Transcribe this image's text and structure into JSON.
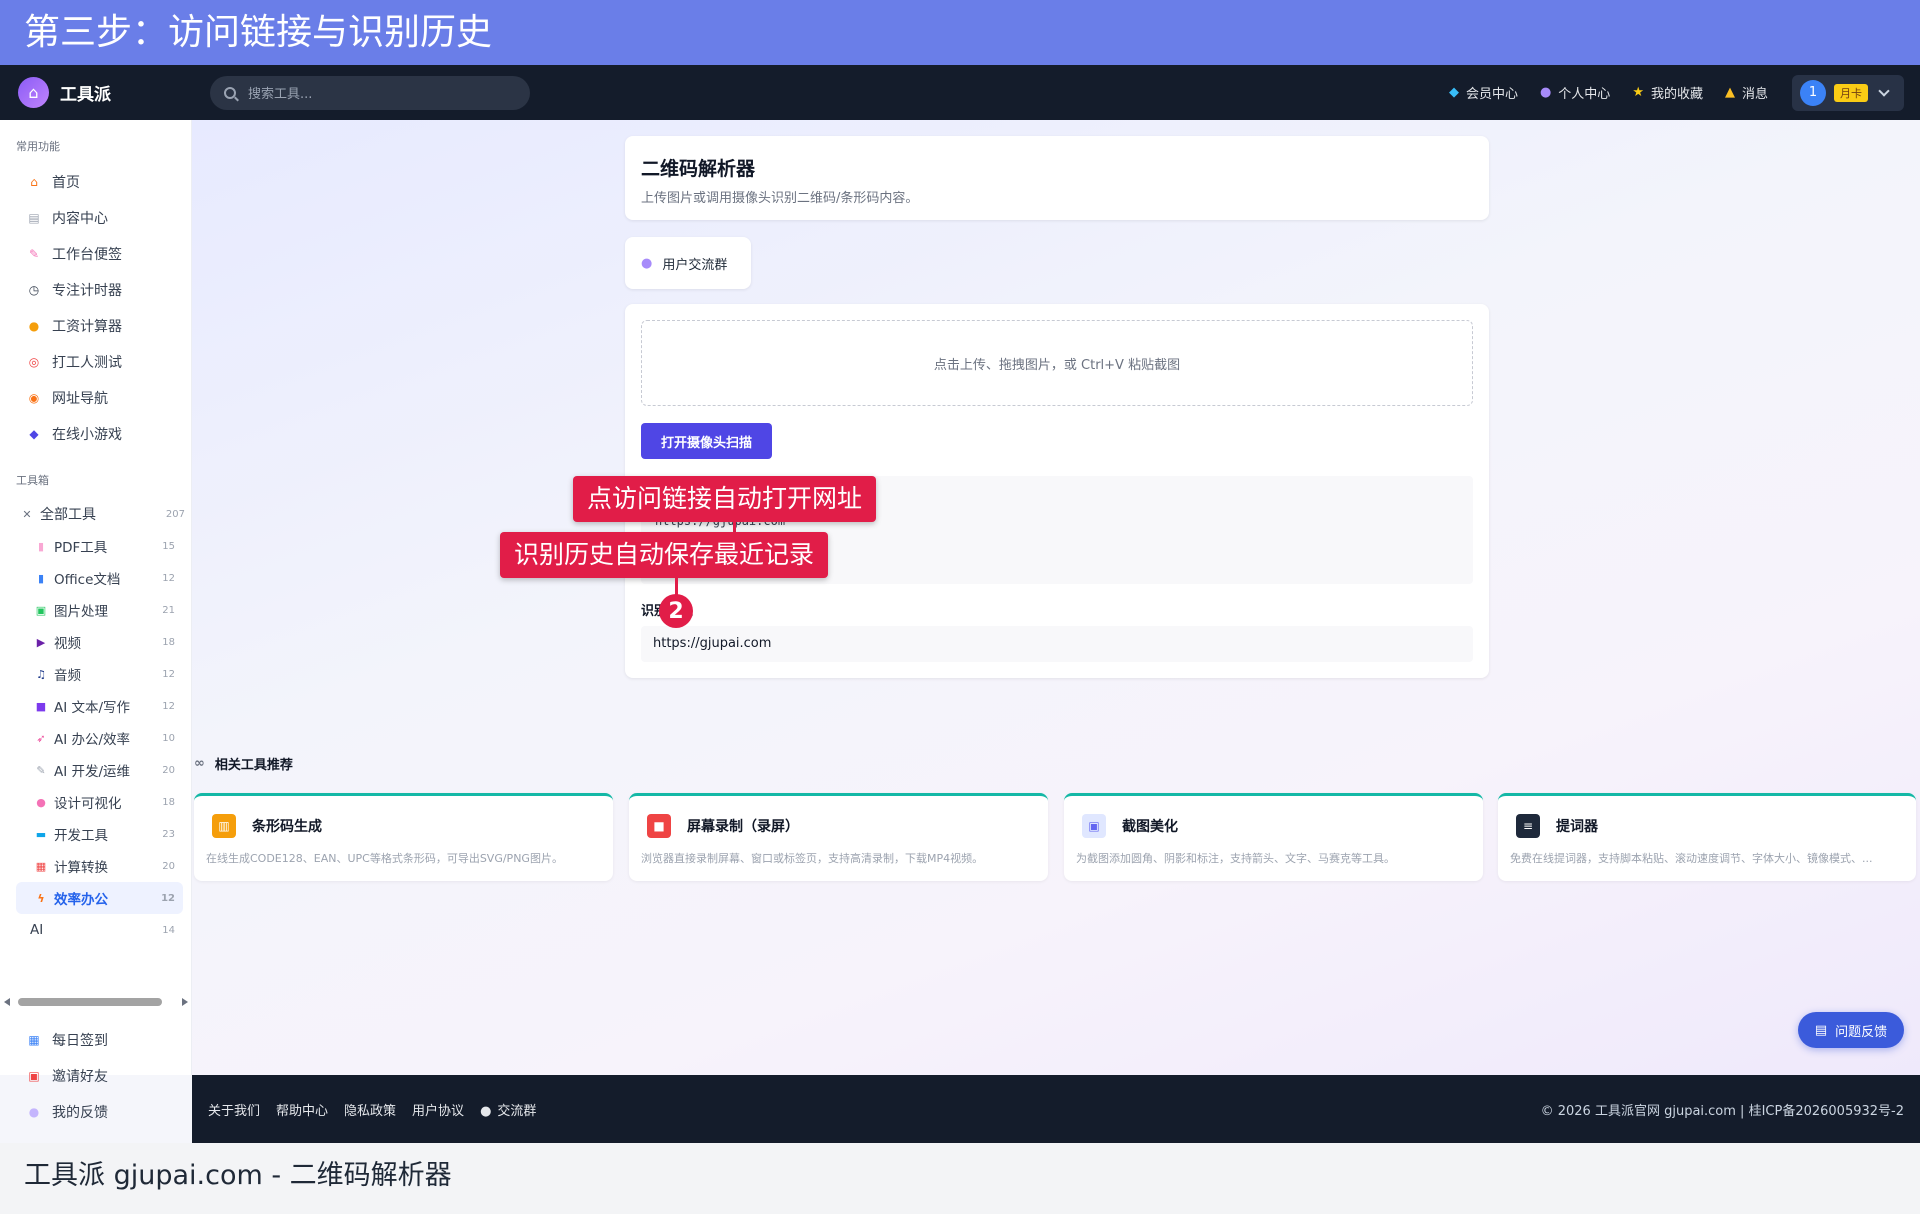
{
  "banner": {
    "title": "第三步：访问链接与识别历史"
  },
  "topbar": {
    "logo_text": "工具派",
    "search_placeholder": "搜索工具...",
    "links": [
      {
        "icon": "diamond-icon",
        "label": "会员中心"
      },
      {
        "icon": "user-icon",
        "label": "个人中心"
      },
      {
        "icon": "star-icon",
        "label": "我的收藏"
      },
      {
        "icon": "bell-icon",
        "label": "消息"
      }
    ],
    "user": {
      "avatar": "1",
      "badge": "月卡"
    }
  },
  "sidebar": {
    "common_title": "常用功能",
    "common_items": [
      {
        "icon": "home-icon",
        "label": "首页"
      },
      {
        "icon": "news-icon",
        "label": "内容中心"
      },
      {
        "icon": "memo-icon",
        "label": "工作台便签"
      },
      {
        "icon": "timer-icon",
        "label": "专注计时器"
      },
      {
        "icon": "money-bag-icon",
        "label": "工资计算器"
      },
      {
        "icon": "target-icon",
        "label": "打工人测试"
      },
      {
        "icon": "compass-icon",
        "label": "网址导航"
      },
      {
        "icon": "gamepad-icon",
        "label": "在线小游戏"
      }
    ],
    "toolbox_title": "工具箱",
    "all_tools": {
      "label": "全部工具",
      "count": "207"
    },
    "tools": [
      {
        "icon": "pdf-icon",
        "label": "PDF工具",
        "count": "15"
      },
      {
        "icon": "book-icon",
        "label": "Office文档",
        "count": "12"
      },
      {
        "icon": "image-icon",
        "label": "图片处理",
        "count": "21"
      },
      {
        "icon": "clapper-icon",
        "label": "视频",
        "count": "18"
      },
      {
        "icon": "music-icon",
        "label": "音频",
        "count": "12"
      },
      {
        "icon": "robot-icon",
        "label": "AI 文本/写作",
        "count": "12"
      },
      {
        "icon": "rocket-icon",
        "label": "AI 办公/效率",
        "count": "10"
      },
      {
        "icon": "wrench-icon",
        "label": "AI 开发/运维",
        "count": "20"
      },
      {
        "icon": "palette-icon",
        "label": "设计可视化",
        "count": "18"
      },
      {
        "icon": "monitor-icon",
        "label": "开发工具",
        "count": "23"
      },
      {
        "icon": "calculator-icon",
        "label": "计算转换",
        "count": "20"
      },
      {
        "icon": "lightning-icon",
        "label": "效率办公",
        "count": "12",
        "active": true
      },
      {
        "icon": "",
        "label": "AI",
        "count": "14"
      }
    ],
    "bottom_items": [
      {
        "icon": "calendar-icon",
        "label": "每日签到"
      },
      {
        "icon": "gift-icon",
        "label": "邀请好友"
      },
      {
        "icon": "chat-icon",
        "label": "我的反馈"
      }
    ]
  },
  "main": {
    "title": "二维码解析器",
    "subtitle": "上传图片或调用摄像头识别二维码/条形码内容。",
    "group_label": "用户交流群",
    "dropzone_text": "点击上传、拖拽图片，或 Ctrl+V 粘贴截图",
    "camera_button": "打开摄像头扫描",
    "result_text": "https://gjupai.com",
    "history_label": "识别历史",
    "history_items": [
      "https://gjupai.com"
    ],
    "related_title": "相关工具推荐",
    "related_tools": [
      {
        "icon": "barcode-icon",
        "color": "#f59e0b",
        "name": "条形码生成",
        "desc": "在线生成CODE128、EAN、UPC等格式条形码，可导出SVG/PNG图片。"
      },
      {
        "icon": "record-icon",
        "color": "#ef4444",
        "name": "屏幕录制（录屏）",
        "desc": "浏览器直接录制屏幕、窗口或标签页，支持高清录制，下载MP4视频。"
      },
      {
        "icon": "picture-icon",
        "color": "#e0e7ff",
        "name": "截图美化",
        "desc": "为截图添加圆角、阴影和标注，支持箭头、文字、马赛克等工具。"
      },
      {
        "icon": "teleprompter-icon",
        "color": "#1e293b",
        "name": "提词器",
        "desc": "免费在线提词器，支持脚本粘贴、滚动速度调节、字体大小、镜像模式、..."
      }
    ],
    "feedback_button": "问题反馈"
  },
  "footer": {
    "links": [
      "关于我们",
      "帮助中心",
      "隐私政策",
      "用户协议",
      "交流群"
    ],
    "copyright": "© 2026 工具派官网 gjupai.com | 桂ICP备2026005932号-2"
  },
  "annotations": {
    "tip1": "点访问链接自动打开网址",
    "tip2": "识别历史自动保存最近记录",
    "step": "2"
  },
  "caption": "工具派 gjupai.com - 二维码解析器"
}
